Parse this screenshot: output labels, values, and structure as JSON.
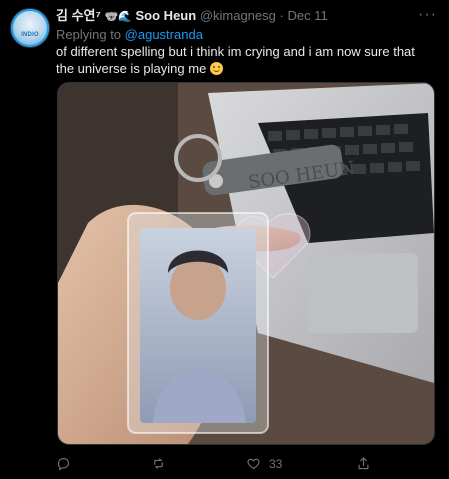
{
  "tweet": {
    "author_name": "김 수연⁷",
    "author_emojis": "🐨🌊",
    "retweeter_name": "Soo Heun",
    "handle": "@kimagnesg",
    "separator": "·",
    "date": "Dec 11",
    "replying_prefix": "Replying to",
    "replying_to": "@agustranda",
    "text": "of different spelling but i think im crying and i am now sure that the universe is playing me",
    "more_label": "···",
    "avatar_tag": "INDIO"
  },
  "media": {
    "keychain_text": "SOO HEUN",
    "description_icon": "photo-keychain"
  },
  "actions": {
    "reply_count": "",
    "retweet_count": "",
    "like_count": "33",
    "share_count": ""
  },
  "colors": {
    "background": "#000000",
    "text": "#e7e9ea",
    "muted": "#71767b",
    "link": "#1d9bf0"
  }
}
